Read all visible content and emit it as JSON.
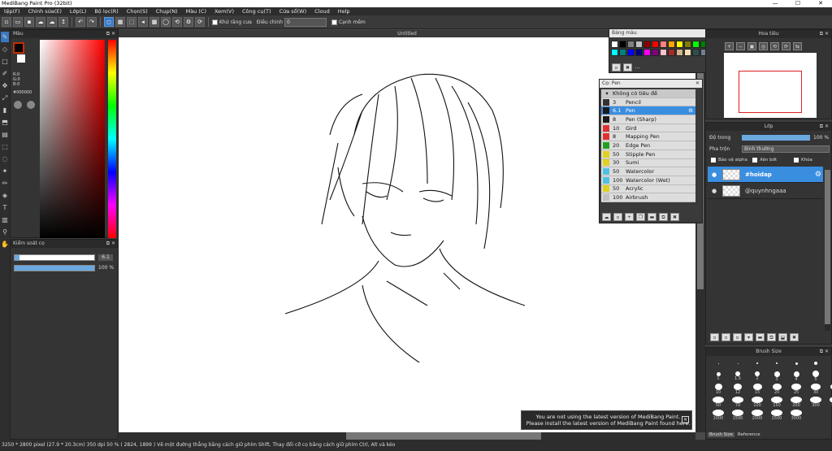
{
  "window": {
    "title": "MediBang Paint Pro (32bit)",
    "min": "—",
    "max": "☐",
    "close": "✕"
  },
  "menu": [
    "tệp(F)",
    "Chỉnh sửa(E)",
    "Lớp(L)",
    "Bộ lọc(R)",
    "Chọn(S)",
    "Chụp(N)",
    "Màu (C)",
    "Xem(V)",
    "Công cụ(T)",
    "Cửa sổ(W)",
    "Cloud",
    "Help"
  ],
  "toolbar": {
    "antialias_label": "Khử răng cưa",
    "adjust_label": "Điều chỉnh",
    "adjust_value": "0",
    "edge_label": "Cạnh mềm"
  },
  "color_panel": {
    "title": "Màu",
    "r": "R:0",
    "g": "G:0",
    "b": "B:0",
    "hex": "#000000"
  },
  "brush_control": {
    "title": "Kiểm soát cọ",
    "size": "6.1",
    "opacity": "100 %"
  },
  "document": {
    "tab": "Untitled"
  },
  "palette": {
    "title": "Bảng màu",
    "more": "...",
    "colors": [
      "#ffffff",
      "#000000",
      "#808080",
      "#c0c0c0",
      "#8b0000",
      "#ff0000",
      "#ff8080",
      "#ffa500",
      "#ffff00",
      "#808000",
      "#00ff00",
      "#008000",
      "#00ffff",
      "#008080",
      "#0000ff",
      "#000080",
      "#ff00ff",
      "#800080",
      "#ffc0cb",
      "#a52a2a",
      "#d2b48c",
      "#f5deb3",
      "#2f4f4f",
      "#708090"
    ]
  },
  "brush_panel": {
    "title": "Cọ: Pen",
    "group": "Không có tiêu đề",
    "items": [
      {
        "size": "3",
        "name": "Pencil",
        "color": "#333333"
      },
      {
        "size": "6.1",
        "name": "Pen",
        "color": "#1a1a1a"
      },
      {
        "size": "8",
        "name": "Pen (Sharp)",
        "color": "#1a1a1a"
      },
      {
        "size": "10",
        "name": "Gird",
        "color": "#e03030"
      },
      {
        "size": "8",
        "name": "Mapping Pen",
        "color": "#e03030"
      },
      {
        "size": "20",
        "name": "Edge Pen",
        "color": "#20a020"
      },
      {
        "size": "50",
        "name": "Stipple Pen",
        "color": "#e0d020"
      },
      {
        "size": "30",
        "name": "Sumi",
        "color": "#e0d020"
      },
      {
        "size": "50",
        "name": "Watercolor",
        "color": "#50c0e0"
      },
      {
        "size": "100",
        "name": "Watercolor (Wet)",
        "color": "#50c0e0"
      },
      {
        "size": "50",
        "name": "Acrylic",
        "color": "#e0d020"
      },
      {
        "size": "100",
        "name": "Airbrush",
        "color": "#c0c0c0"
      }
    ]
  },
  "navigator": {
    "title": "Hoa tiêu"
  },
  "layer_panel": {
    "title": "Lớp",
    "opacity_label": "Độ trong",
    "opacity_value": "100 %",
    "blend_label": "Pha trộn",
    "blend_value": "Bình thường",
    "protect_alpha": "Bảo vệ alpha",
    "clipping": "Xén bớt",
    "lock": "Khóa",
    "layers": [
      "#hoidap",
      "@quynhngaaa"
    ]
  },
  "brush_size_panel": {
    "title": "Brush Size",
    "tabs": [
      "Brush Size",
      "Reference"
    ],
    "sizes": [
      "",
      "",
      "",
      "",
      "",
      "",
      "",
      "1",
      "1.5",
      "2",
      "3",
      "4",
      "5",
      "7",
      "10",
      "12",
      "15",
      "20",
      "25",
      "30",
      "40",
      "50",
      "70",
      "100",
      "150",
      "200",
      "300",
      "500",
      "1000",
      "1500",
      "2000",
      "2500",
      "3000"
    ]
  },
  "notification": {
    "line1": "You are not using the latest version of MediBang Paint.",
    "line2": "Please install the latest version of MediBang Paint found here."
  },
  "status": "3250 * 2800 pixel   (27.9 * 20.3cm)   350 dpi   50 %   ( 2824, 1899 )   Vẽ một đường thẳng bằng cách giữ phím Shift, Thay đổi cỡ cọ bằng cách giữ phím Ctrl, Alt và kéo"
}
